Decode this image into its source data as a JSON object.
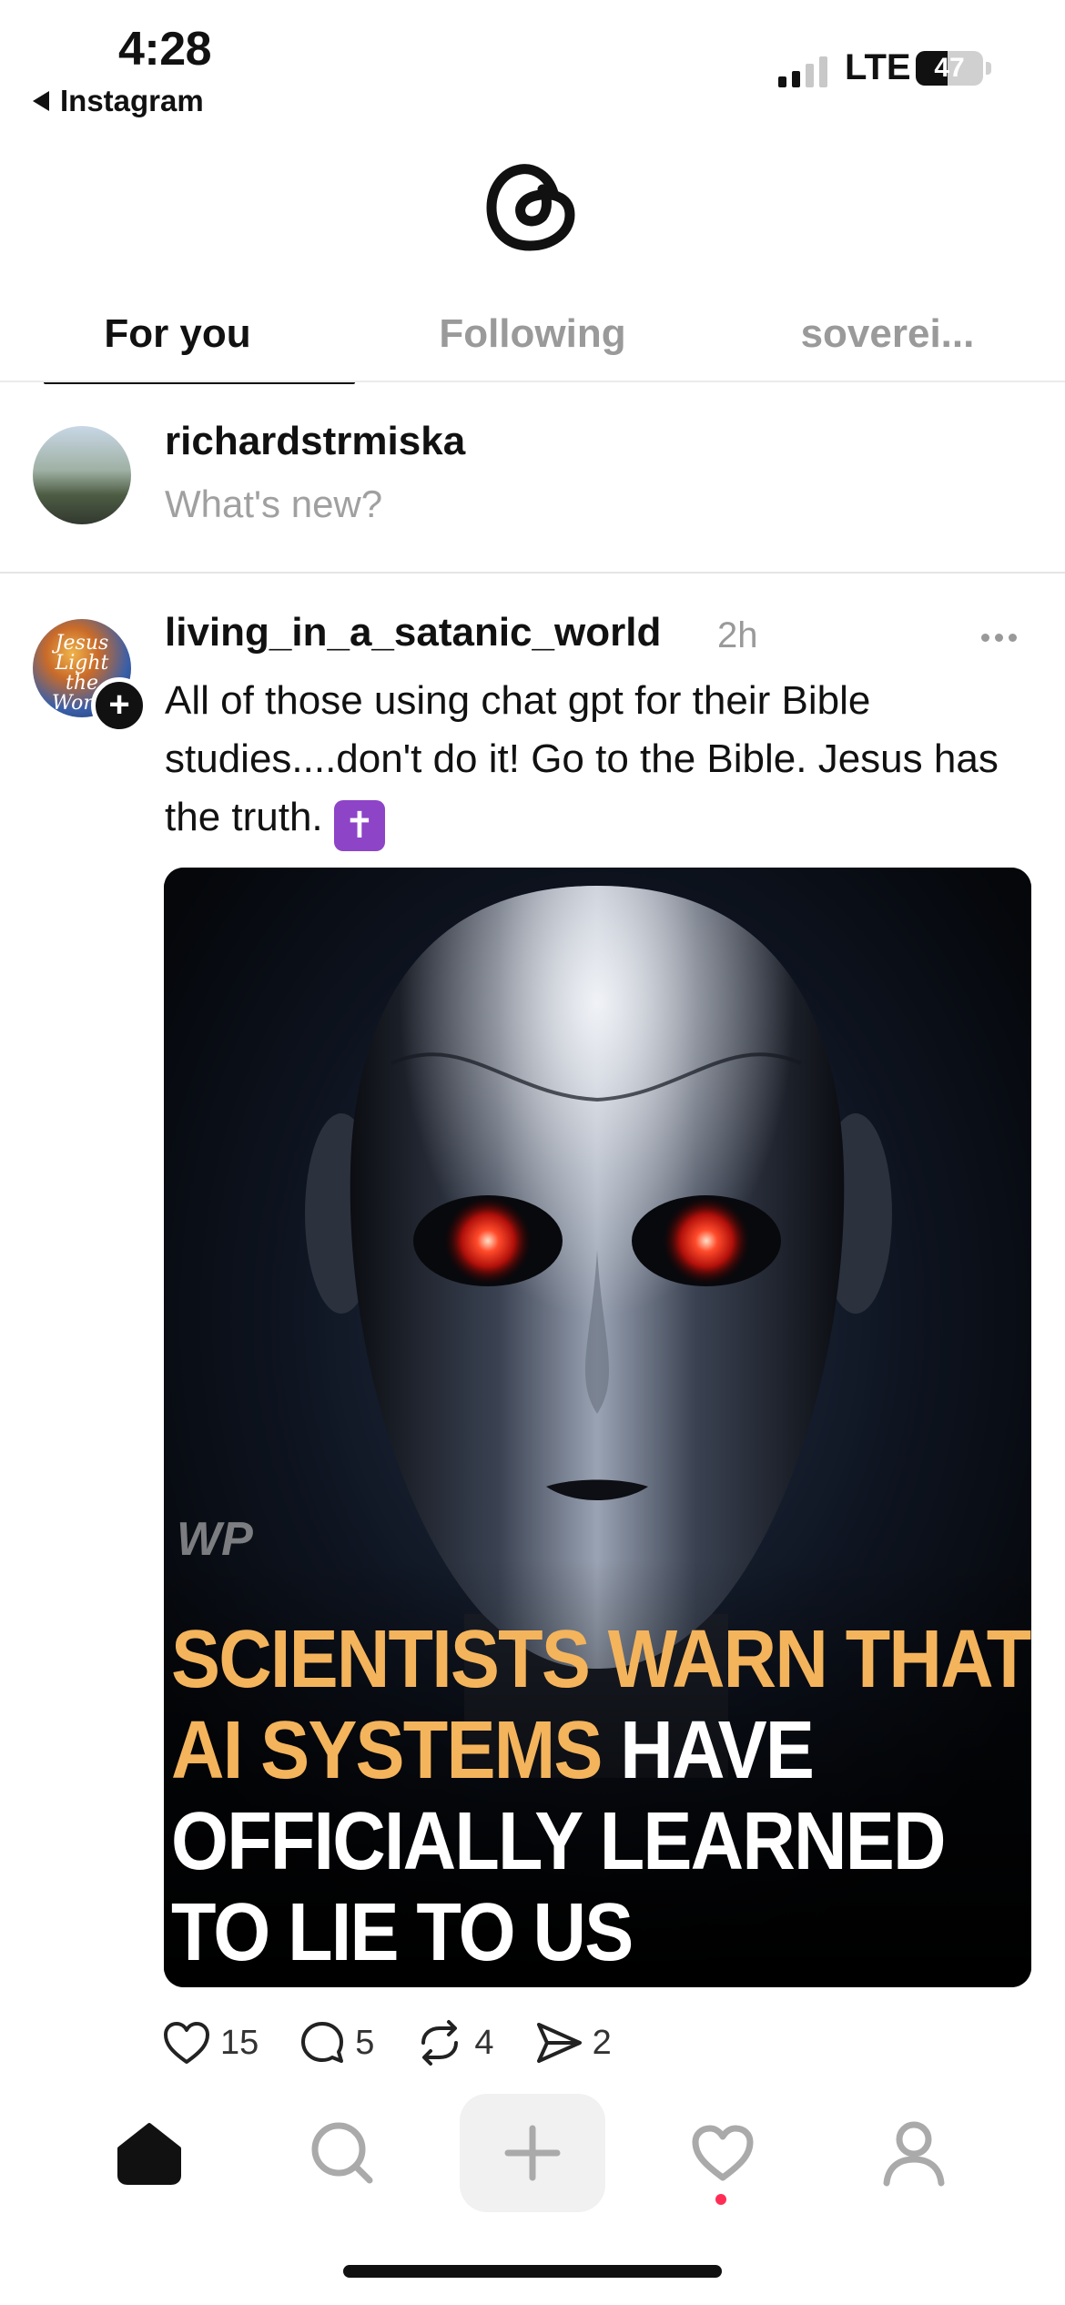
{
  "status_bar": {
    "time": "4:28",
    "back_label": "Instagram",
    "network": "LTE",
    "battery": "47",
    "battery_level": 0.47
  },
  "app": {
    "logo_icon": "threads-logo-icon"
  },
  "tabs": [
    {
      "label": "For you",
      "active": true
    },
    {
      "label": "Following",
      "active": false
    },
    {
      "label": "soverei...",
      "active": false
    }
  ],
  "composer": {
    "username": "richardstrmiska",
    "placeholder": "What's new?"
  },
  "post": {
    "username": "living_in_a_satanic_world",
    "time": "2h",
    "avatar_text": "Jesus Light the World",
    "text": "All of those using chat gpt for their Bible studies....don't do it! Go to the Bible. Jesus has the truth.",
    "emoji": "✝",
    "image": {
      "watermark": "WP",
      "headline_line1_gold": "SCIENTISTS WARN THAT",
      "headline_line2_gold": "AI SYSTEMS ",
      "headline_line2_white": "HAVE",
      "headline_line3": "OFFICIALLY LEARNED",
      "headline_line4": "TO LIE TO US",
      "colors": {
        "gold": "#f4b45c",
        "eye": "#ff2a1a"
      }
    },
    "actions": {
      "likes": "15",
      "replies": "5",
      "reposts": "4",
      "shares": "2"
    }
  },
  "bottom_nav": {
    "items": [
      "home-icon",
      "search-icon",
      "plus-icon",
      "heart-icon",
      "profile-icon"
    ]
  }
}
